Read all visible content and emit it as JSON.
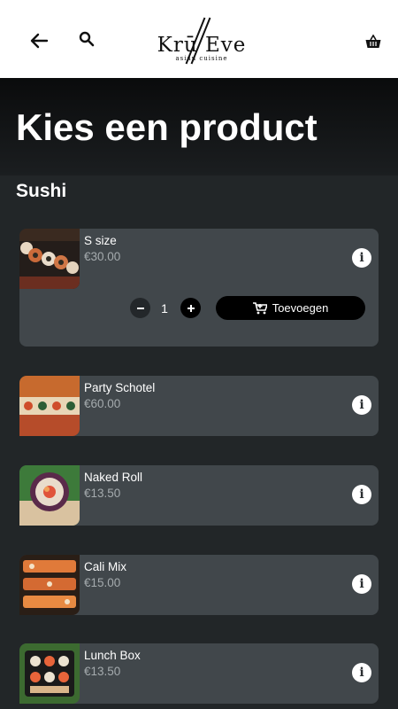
{
  "header": {
    "logo_text": "Krū Eve",
    "logo_sub": "asian cuisine",
    "icons": [
      "back-arrow-icon",
      "search-icon",
      "basket-icon"
    ]
  },
  "page": {
    "title": "Kies een product",
    "section": "Sushi"
  },
  "products": [
    {
      "name": "S size",
      "price": "€30.00"
    },
    {
      "name": "Party Schotel",
      "price": "€60.00"
    },
    {
      "name": "Naked Roll",
      "price": "€13.50"
    },
    {
      "name": "Cali Mix",
      "price": "€15.00"
    },
    {
      "name": "Lunch Box",
      "price": "€13.50"
    }
  ],
  "expanded": {
    "quantity": "1",
    "add_label": "Toevoegen"
  },
  "colors": {
    "background": "#222628",
    "card": "#41474b",
    "price": "#a5abae",
    "button": "#000000"
  }
}
